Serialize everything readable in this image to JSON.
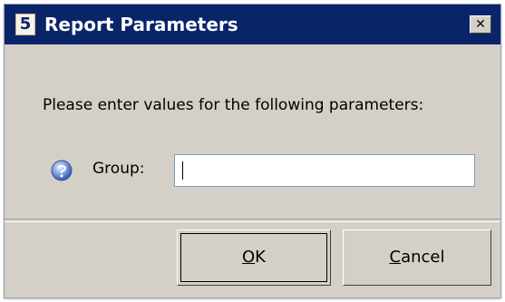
{
  "window": {
    "icon_label": "5",
    "title": "Report Parameters",
    "close_label": "✕"
  },
  "prompt": "Please enter values for the following parameters:",
  "parameters": [
    {
      "label": "Group:",
      "value": "",
      "icon": "parameter-help-icon"
    }
  ],
  "buttons": {
    "ok": {
      "mnemonic": "O",
      "rest": "K"
    },
    "cancel": {
      "mnemonic": "C",
      "rest": "ancel"
    }
  },
  "colors": {
    "title_bar": "#0a246a",
    "dialog_bg": "#d4d0c8",
    "input_border": "#7f9db9"
  }
}
